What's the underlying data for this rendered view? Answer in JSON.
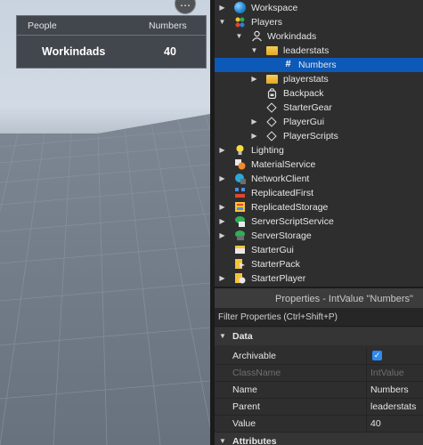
{
  "leaderboard": {
    "col_people": "People",
    "col_numbers": "Numbers",
    "row": {
      "player": "Workindads",
      "value": "40"
    }
  },
  "viewport": {
    "more_button": "⋯"
  },
  "explorer": {
    "items": [
      {
        "label": "Workspace",
        "icon": "workspace-globe-icon"
      },
      {
        "label": "Players",
        "icon": "players-icon"
      },
      {
        "label": "Workindads",
        "icon": "player-user-icon"
      },
      {
        "label": "leaderstats",
        "icon": "folder-icon"
      },
      {
        "label": "Numbers",
        "icon": "intvalue-hash-icon"
      },
      {
        "label": "playerstats",
        "icon": "folder-icon"
      },
      {
        "label": "Backpack",
        "icon": "backpack-icon"
      },
      {
        "label": "StarterGear",
        "icon": "diamond-icon"
      },
      {
        "label": "PlayerGui",
        "icon": "diamond-icon"
      },
      {
        "label": "PlayerScripts",
        "icon": "diamond-icon"
      },
      {
        "label": "Lighting",
        "icon": "lighting-bulb-icon"
      },
      {
        "label": "MaterialService",
        "icon": "material-service-icon"
      },
      {
        "label": "NetworkClient",
        "icon": "network-client-icon"
      },
      {
        "label": "ReplicatedFirst",
        "icon": "replicated-first-icon"
      },
      {
        "label": "ReplicatedStorage",
        "icon": "replicated-storage-icon"
      },
      {
        "label": "ServerScriptService",
        "icon": "server-script-service-icon"
      },
      {
        "label": "ServerStorage",
        "icon": "server-storage-icon"
      },
      {
        "label": "StarterGui",
        "icon": "starter-gui-icon"
      },
      {
        "label": "StarterPack",
        "icon": "starter-pack-icon"
      },
      {
        "label": "StarterPlayer",
        "icon": "starter-player-icon"
      }
    ],
    "selected": "Numbers"
  },
  "properties": {
    "title": "Properties - IntValue \"Numbers\"",
    "filter_placeholder": "Filter Properties (Ctrl+Shift+P)",
    "category_data": "Data",
    "category_attributes": "Attributes",
    "rows": [
      {
        "name": "Archivable",
        "value": "",
        "checked": true
      },
      {
        "name": "ClassName",
        "value": "IntValue"
      },
      {
        "name": "Name",
        "value": "Numbers"
      },
      {
        "name": "Parent",
        "value": "leaderstats"
      },
      {
        "name": "Value",
        "value": "40"
      }
    ]
  },
  "colors": {
    "selection": "#0c59b8",
    "panel": "#2e2e2e",
    "checkbox": "#2e8bef"
  }
}
